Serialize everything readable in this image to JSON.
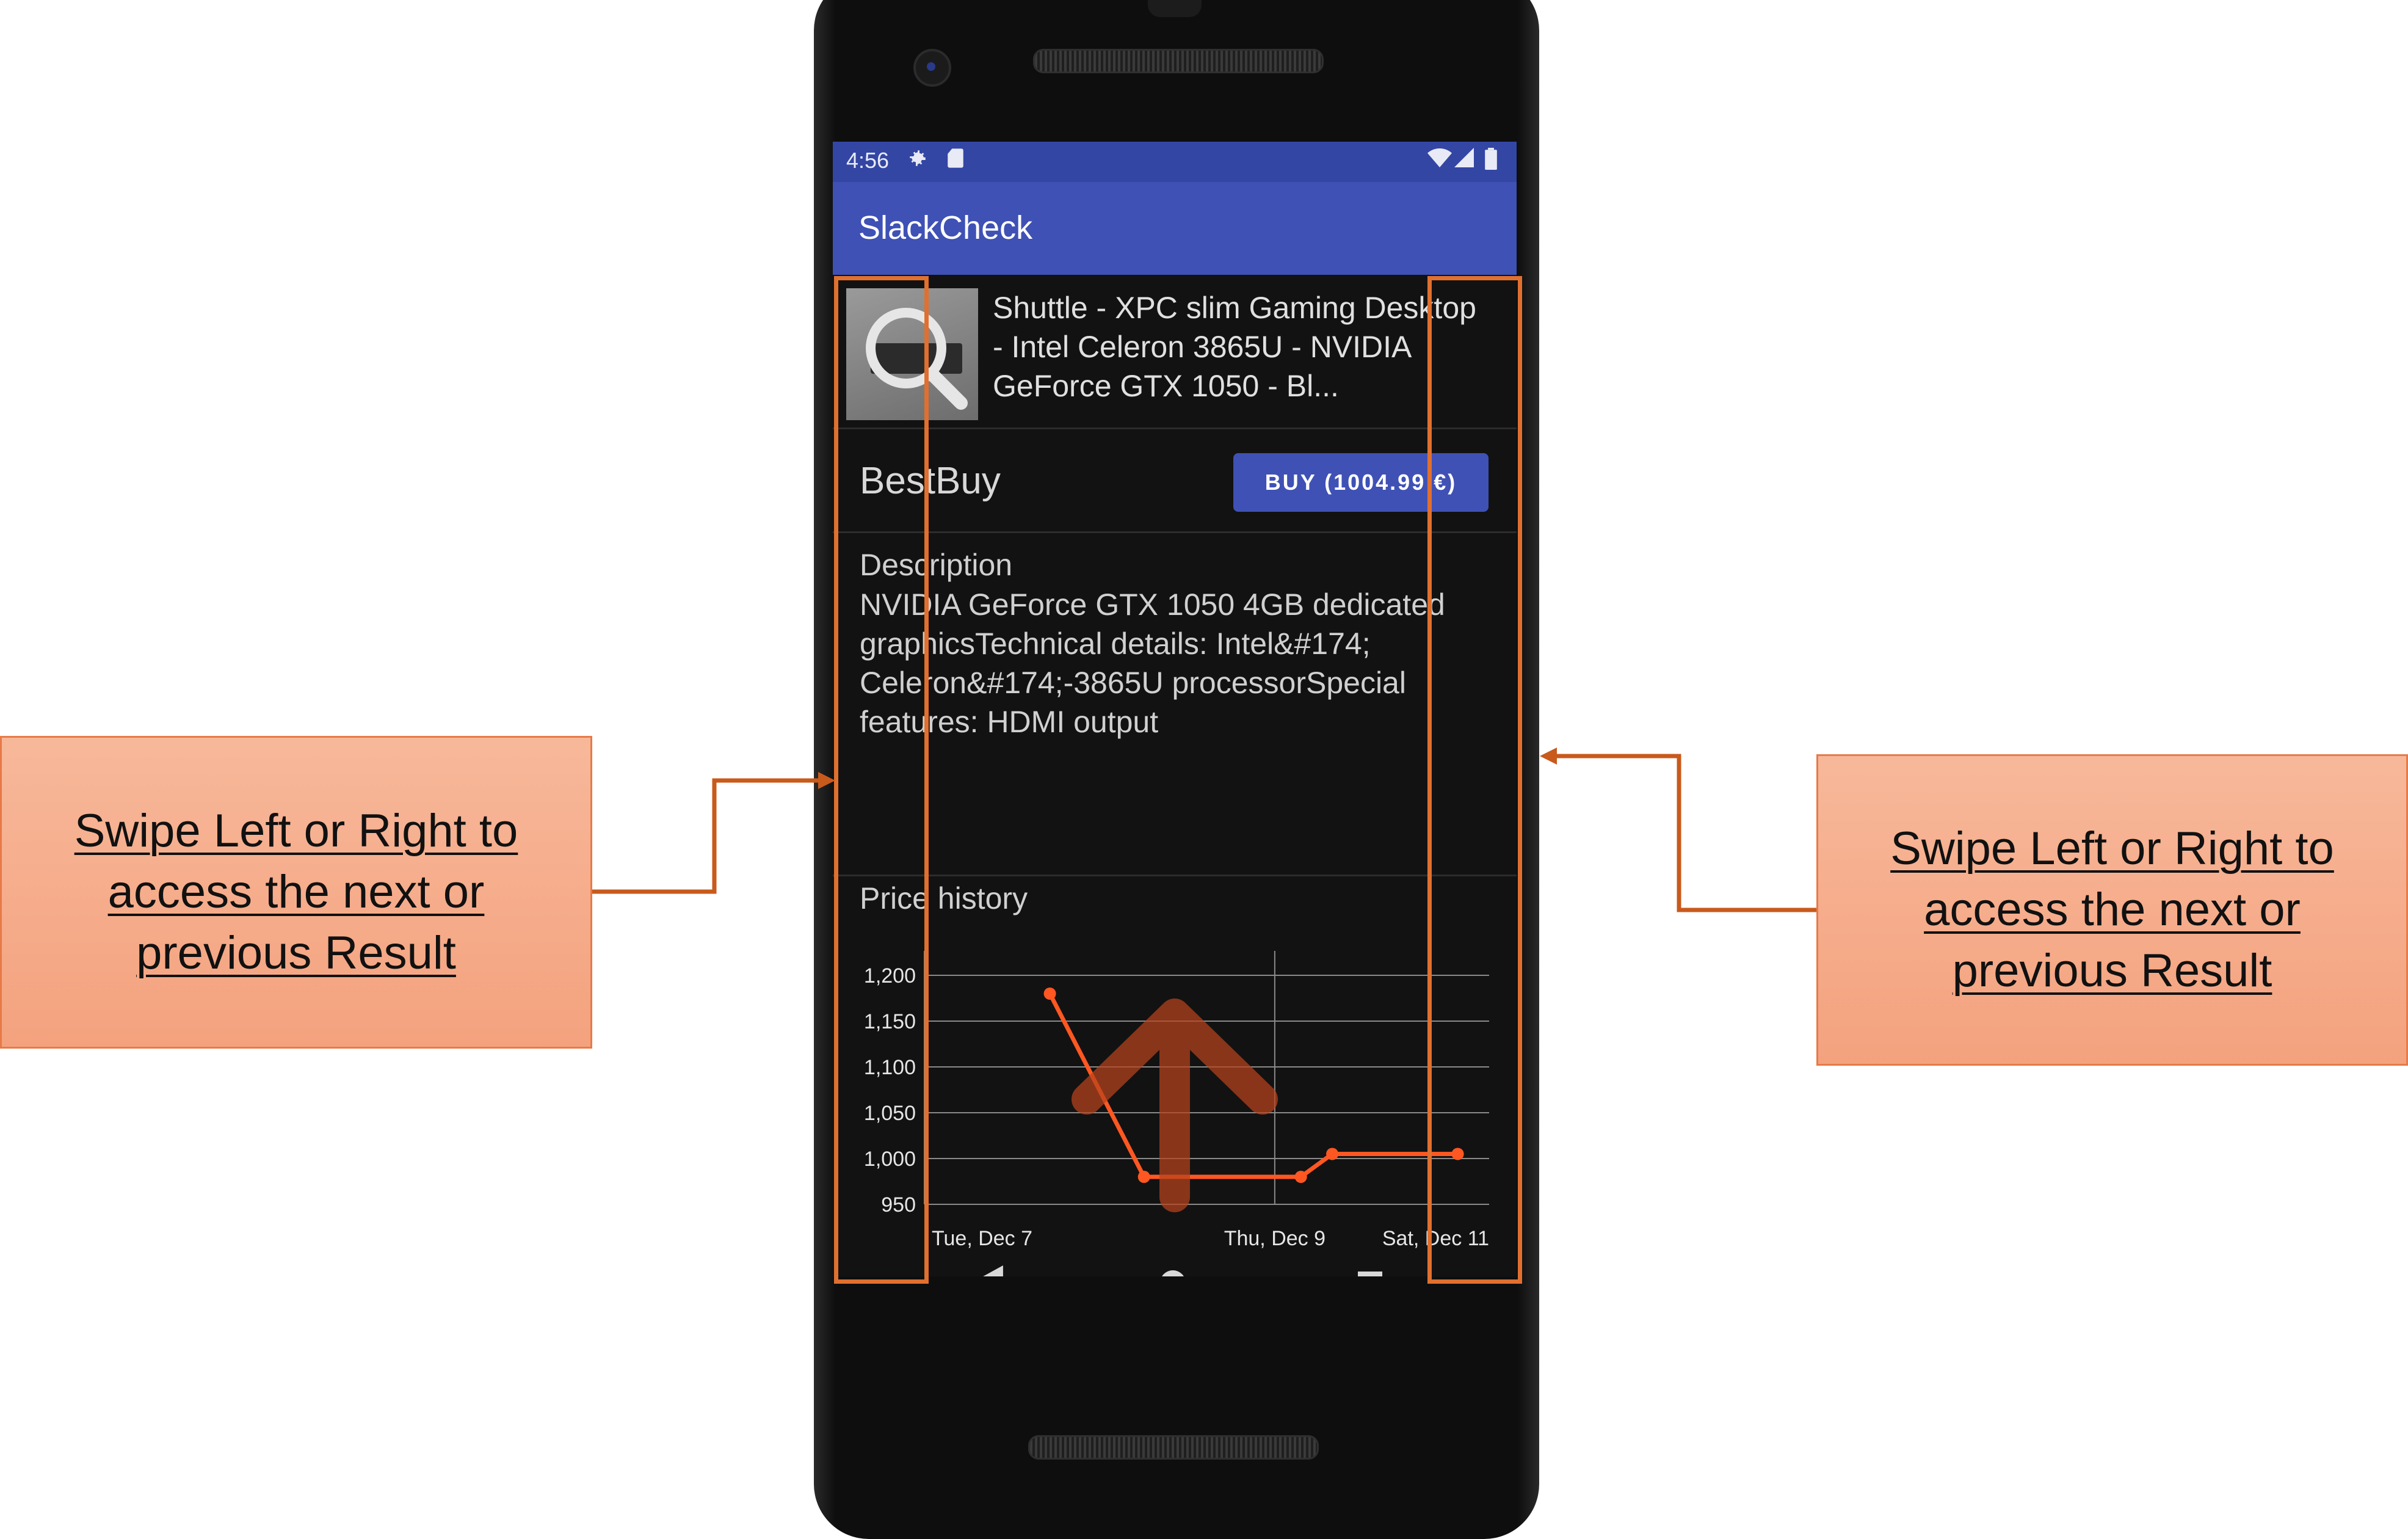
{
  "status_bar": {
    "time": "4:56"
  },
  "app_bar": {
    "title": "SlackCheck"
  },
  "product": {
    "title": "Shuttle - XPC slim Gaming Desktop - Intel Celeron 3865U - NVIDIA GeForce GTX 1050 - Bl...",
    "store": "BestBuy",
    "buy_label": "BUY (1004.99 €)"
  },
  "description": {
    "heading": "Description",
    "body": "NVIDIA GeForce GTX 1050 4GB dedicated graphicsTechnical details: Intel&#174; Celeron&#174;-3865U processorSpecial features: HDMI output"
  },
  "price_history": {
    "heading": "Price history"
  },
  "callouts": {
    "left": "Swipe Left or Right to access the next or previous Result",
    "right": "Swipe Left or Right to access the next or previous Result"
  },
  "icons": {
    "status": [
      "gear-icon",
      "sd-card-icon",
      "wifi-icon",
      "signal-icon",
      "battery-icon"
    ],
    "nav": [
      "back-icon",
      "home-icon",
      "recents-icon"
    ],
    "overlay": "swipe-up-arrow-icon"
  },
  "colors": {
    "accent": "#3f51b5",
    "status_bar": "#3346a4",
    "callout_fill": "#f4a27e",
    "callout_border": "#e77a48",
    "overlay_stroke": "#e0702f",
    "chart_line": "#ff5722"
  },
  "chart_data": {
    "type": "line",
    "title": "Price history",
    "xlabel": "",
    "ylabel": "",
    "x_tick_labels": [
      "Tue, Dec 7",
      "Thu, Dec 9",
      "Sat, Dec 11"
    ],
    "y_ticks": [
      950,
      1000,
      1050,
      1100,
      1150,
      1200
    ],
    "y_tick_labels": [
      "950",
      "1,000",
      "1,050",
      "1,100",
      "1,150",
      "1,200"
    ],
    "ylim": [
      950,
      1220
    ],
    "x_range": [
      "2021-12-06 12:00",
      "2021-12-11"
    ],
    "grid": true,
    "series": [
      {
        "points": [
          {
            "x": "2021-12-07 12:00",
            "y": 1180
          },
          {
            "x": "2021-12-08 06:00",
            "y": 980
          },
          {
            "x": "2021-12-09 12:00",
            "y": 980
          },
          {
            "x": "2021-12-09 18:00",
            "y": 1005
          },
          {
            "x": "2021-12-10 18:00",
            "y": 1005
          }
        ]
      }
    ]
  }
}
